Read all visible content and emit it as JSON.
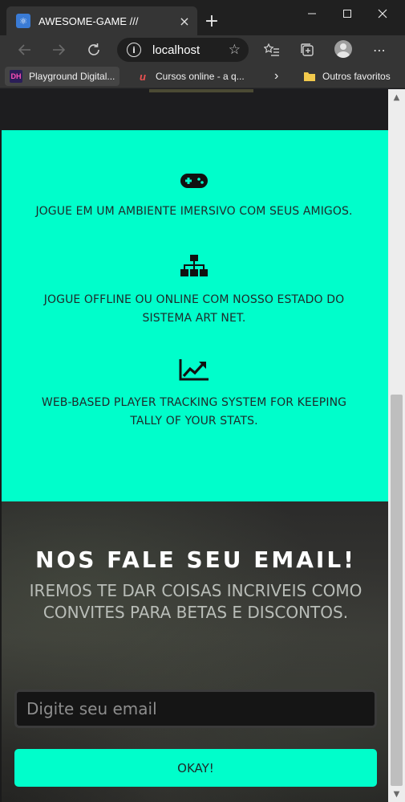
{
  "browser": {
    "tab_title": "AWESOME-GAME ///",
    "tab_close_icon": "×",
    "new_tab_icon": "+",
    "url": "localhost",
    "bookmarks": [
      {
        "label": "Playground Digital...",
        "icon_text": "DH"
      },
      {
        "label": "Cursos online - a q...",
        "icon_text": "u"
      }
    ],
    "other_favorites": "Outros favoritos"
  },
  "features": {
    "items": [
      {
        "icon": "gamepad-icon",
        "text": "JOGUE EM UM AMBIENTE IMERSIVO COM SEUS AMIGOS."
      },
      {
        "icon": "network-icon",
        "text": "JOGUE OFFLINE OU ONLINE COM NOSSO ESTADO DO SISTEMA ART NET."
      },
      {
        "icon": "chart-line-icon",
        "text": "WEB-BASED PLAYER TRACKING SYSTEM FOR KEEPING TALLY OF YOUR STATS."
      }
    ],
    "background": "#00fecb"
  },
  "signup": {
    "title": "NOS FALE SEU EMAIL!",
    "subtitle": "IREMOS TE DAR COISAS INCRIVEIS COMO CONVITES PARA BETAS E DISCONTOS.",
    "email_placeholder": "Digite seu email",
    "button_label": "OKAY!"
  },
  "colors": {
    "accent": "#00fecb",
    "dark": "#1f1f1f"
  }
}
